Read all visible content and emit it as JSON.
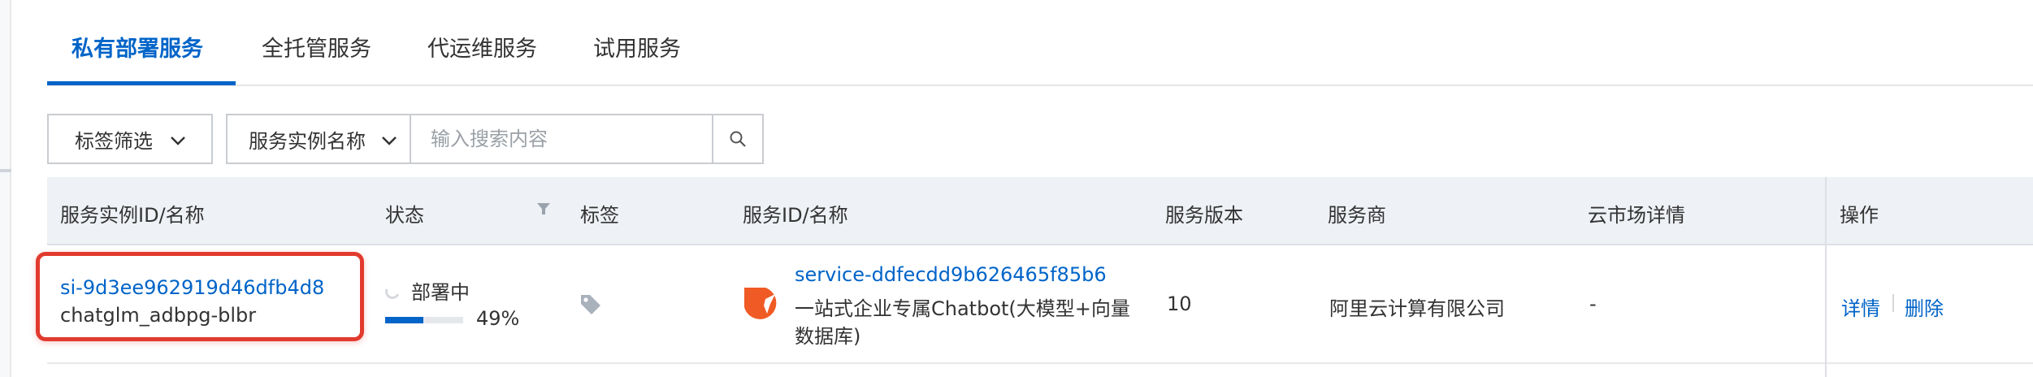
{
  "tabs": [
    {
      "label": "私有部署服务",
      "active": true
    },
    {
      "label": "全托管服务",
      "active": false
    },
    {
      "label": "代运维服务",
      "active": false
    },
    {
      "label": "试用服务",
      "active": false
    }
  ],
  "filters": {
    "tag_filter_label": "标签筛选",
    "search_field_label": "服务实例名称",
    "search_placeholder": "输入搜索内容"
  },
  "table": {
    "columns": [
      "服务实例ID/名称",
      "状态",
      "标签",
      "服务ID/名称",
      "服务版本",
      "服务商",
      "云市场详情",
      "操作"
    ],
    "rows": [
      {
        "instance_id": "si-9d3ee962919d46dfb4d8",
        "instance_name": "chatglm_adbpg-blbr",
        "status": "部署中",
        "progress_text": "49%",
        "progress": 0.49,
        "service_id": "service-ddfecdd9b626465f85b6",
        "service_name_line1": "一站式企业专属Chatbot(大模型+向量",
        "service_name_line2": "数据库)",
        "version": "10",
        "vendor": "阿里云计算有限公司",
        "market_detail": "-",
        "actions": {
          "detail": "详情",
          "delete": "删除"
        }
      }
    ]
  },
  "colors": {
    "accent": "#0064c8",
    "highlight": "#e23a2e",
    "service_logo": "#f05a24"
  }
}
